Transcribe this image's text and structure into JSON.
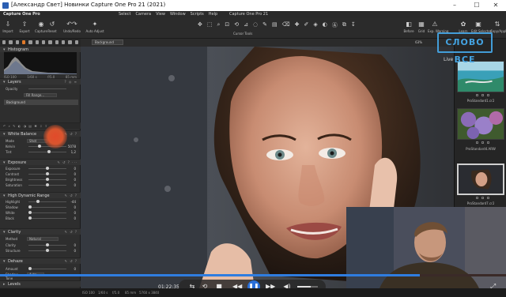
{
  "window": {
    "title": "[Александр Свет] Новинки Capture One Pro 21 (2021)",
    "min_icon": "minimize-icon",
    "max_icon": "maximize-icon",
    "close_icon": "close-icon"
  },
  "menubar": {
    "brand": "Capture One Pro",
    "items": [
      "Select",
      "Camera",
      "View",
      "Window",
      "Scripts",
      "Help"
    ],
    "document": "Capture One Pro 21"
  },
  "toolbar": {
    "left": [
      {
        "label": "Import",
        "icon": "import-icon"
      },
      {
        "label": "Export",
        "icon": "export-icon"
      },
      {
        "label": "Capture",
        "icon": "capture-icon"
      }
    ],
    "history": [
      {
        "label": "Reset",
        "icon": "reset-icon"
      },
      {
        "label": "Undo/Redo",
        "icon": "undo-redo-icon"
      }
    ],
    "auto_adjust": {
      "label": "Auto Adjust",
      "icon": "wand-icon"
    },
    "cursor_tools_label": "Cursor Tools",
    "right": [
      {
        "label": "Before",
        "icon": "before-icon"
      },
      {
        "label": "Grid",
        "icon": "grid-icon"
      },
      {
        "label": "Exp. Warning",
        "icon": "warning-icon"
      },
      {
        "label": "Learn",
        "icon": "learn-icon"
      },
      {
        "label": "Edit Selected",
        "icon": "edit-icon"
      },
      {
        "label": "Copy/Apply",
        "icon": "copy-apply-icon"
      }
    ]
  },
  "left_panel": {
    "histogram": {
      "title": "Histogram",
      "readout": [
        "ISO 100",
        "1/60 s",
        "f/5.0",
        "85 mm"
      ]
    },
    "layers": {
      "title": "Layers",
      "opacity_label": "Opacity",
      "fill_mask": "Fill Range...",
      "background": "Background"
    },
    "white_balance": {
      "title": "White Balance",
      "mode_label": "Mode",
      "mode_value": "Shot",
      "rows": [
        {
          "label": "Kelvin",
          "value": "5078"
        },
        {
          "label": "Tint",
          "value": "1,2"
        }
      ]
    },
    "exposure": {
      "title": "Exposure",
      "rows": [
        {
          "label": "Exposure",
          "value": "0"
        },
        {
          "label": "Contrast",
          "value": "0"
        },
        {
          "label": "Brightness",
          "value": "0"
        },
        {
          "label": "Saturation",
          "value": "0"
        }
      ]
    },
    "hdr": {
      "title": "High Dynamic Range",
      "rows": [
        {
          "label": "Highlight",
          "value": "-44"
        },
        {
          "label": "Shadow",
          "value": "0"
        },
        {
          "label": "White",
          "value": "0"
        },
        {
          "label": "Black",
          "value": "0"
        }
      ]
    },
    "clarity": {
      "title": "Clarity",
      "method_label": "Method",
      "method_value": "Natural",
      "rows": [
        {
          "label": "Clarity",
          "value": "0"
        },
        {
          "label": "Structure",
          "value": "0"
        }
      ]
    },
    "dehaze": {
      "title": "Dehaze",
      "rows": [
        {
          "label": "Amount",
          "value": "0"
        }
      ],
      "shadow_tone_label": "Shadow Tone",
      "shadow_tone_value": "Auto"
    },
    "levels": {
      "title": "Levels"
    }
  },
  "viewer": {
    "layer_select": "Background",
    "zoom": "63%"
  },
  "right_panel": {
    "stamp": "СЛОВО ВСЕ",
    "live_label": "Live",
    "thumbs": [
      {
        "name": "ProStandard1.cr2"
      },
      {
        "name": "ProStandard4.ARW"
      },
      {
        "name": "ProStandard7.cr2"
      }
    ]
  },
  "player": {
    "time": "01:22:35",
    "progress": 0.83,
    "volume": 0.65,
    "icons": [
      "subtitles-icon",
      "replay-icon",
      "stop-icon",
      "rewind-icon",
      "play-pause-icon",
      "forward-icon",
      "volume-icon",
      "fullscreen-icon"
    ]
  },
  "status_bar": [
    "ISO 100",
    "1/60 s",
    "f/5.0",
    "85 mm",
    "5760 x 3840"
  ]
}
